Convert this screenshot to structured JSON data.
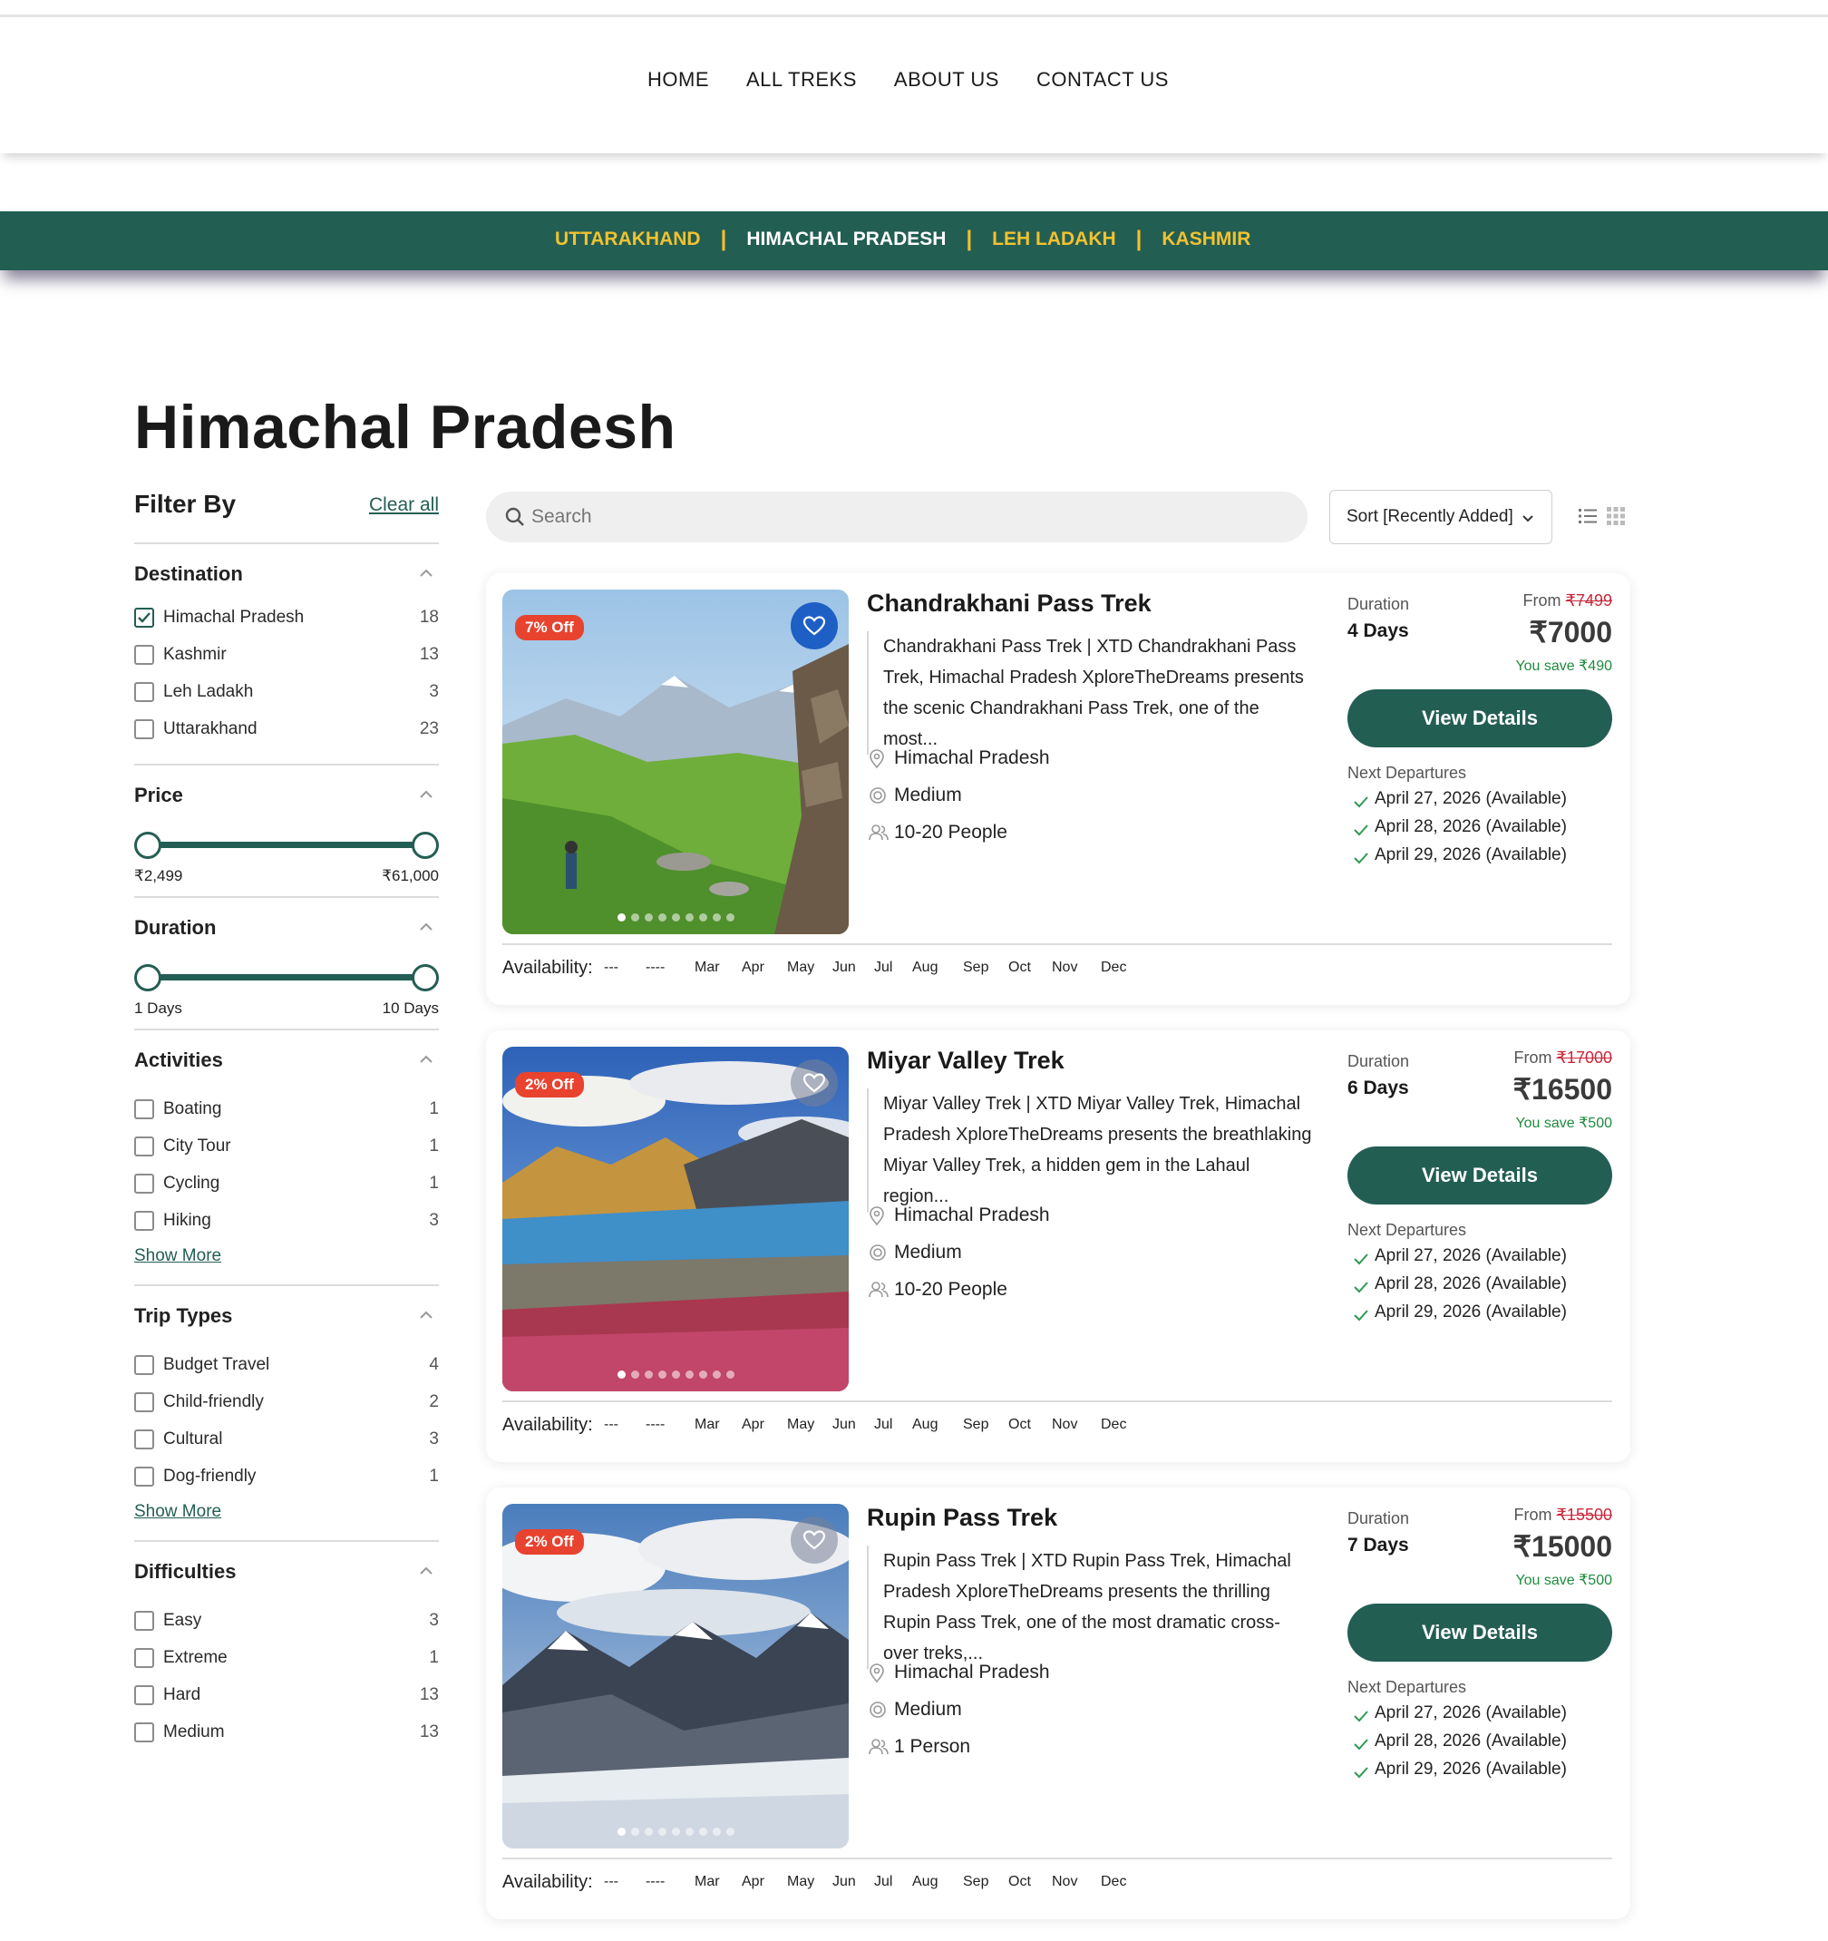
{
  "nav": [
    "HOME",
    "ALL TREKS",
    "ABOUT US",
    "CONTACT US"
  ],
  "regions": [
    {
      "label": "UTTARAKHAND",
      "active": false
    },
    {
      "label": "HIMACHAL PRADESH",
      "active": true
    },
    {
      "label": "LEH LADAKH",
      "active": false
    },
    {
      "label": "KASHMIR",
      "active": false
    }
  ],
  "page": {
    "title": "Himachal Pradesh"
  },
  "filters": {
    "title": "Filter By",
    "clear_label": "Clear all",
    "show_more": "Show More",
    "destination": {
      "title": "Destination",
      "items": [
        {
          "label": "Himachal Pradesh",
          "count": "18",
          "checked": true
        },
        {
          "label": "Kashmir",
          "count": "13",
          "checked": false
        },
        {
          "label": "Leh Ladakh",
          "count": "3",
          "checked": false
        },
        {
          "label": "Uttarakhand",
          "count": "23",
          "checked": false
        }
      ]
    },
    "price": {
      "title": "Price",
      "min": "₹2,499",
      "max": "₹61,000"
    },
    "duration": {
      "title": "Duration",
      "min": "1 Days",
      "max": "10 Days"
    },
    "activities": {
      "title": "Activities",
      "items": [
        {
          "label": "Boating",
          "count": "1"
        },
        {
          "label": "City Tour",
          "count": "1"
        },
        {
          "label": "Cycling",
          "count": "1"
        },
        {
          "label": "Hiking",
          "count": "3"
        }
      ]
    },
    "trip_types": {
      "title": "Trip Types",
      "items": [
        {
          "label": "Budget Travel",
          "count": "4"
        },
        {
          "label": "Child-friendly",
          "count": "2"
        },
        {
          "label": "Cultural",
          "count": "3"
        },
        {
          "label": "Dog-friendly",
          "count": "1"
        }
      ]
    },
    "difficulties": {
      "title": "Difficulties",
      "items": [
        {
          "label": "Easy",
          "count": "3"
        },
        {
          "label": "Extreme",
          "count": "1"
        },
        {
          "label": "Hard",
          "count": "13"
        },
        {
          "label": "Medium",
          "count": "13"
        }
      ]
    }
  },
  "search": {
    "placeholder": "Search"
  },
  "sort": {
    "label": "Sort [Recently Added]"
  },
  "card_labels": {
    "duration": "Duration",
    "from": "From",
    "view_details": "View Details",
    "next_departures": "Next Departures",
    "availability": "Availability:",
    "months": [
      "---",
      "----",
      "Mar",
      "Apr",
      "May",
      "Jun",
      "Jul",
      "Aug",
      "Sep",
      "Oct",
      "Nov",
      "Dec"
    ]
  },
  "treks": [
    {
      "discount": "7% Off",
      "title": "Chandrakhani Pass Trek",
      "description": "Chandrakhani Pass Trek | XTD Chandrakhani Pass Trek, Himachal Pradesh XploreTheDreams presents the scenic Chandrakhani Pass Trek, one of the most...",
      "location": "Himachal Pradesh",
      "difficulty": "Medium",
      "group": "10-20 People",
      "duration": "4 Days",
      "old_price": "₹7499",
      "price": "₹7000",
      "save": "You save ₹490",
      "departures": [
        "April 27, 2026 (Available)",
        "April 28, 2026 (Available)",
        "April 29, 2026 (Available)"
      ],
      "favorited": true
    },
    {
      "discount": "2% Off",
      "title": "Miyar Valley Trek",
      "description": "Miyar Valley Trek | XTD Miyar Valley Trek, Himachal Pradesh XploreTheDreams presents the breathlaking Miyar Valley Trek, a hidden gem in the Lahaul region...",
      "location": "Himachal Pradesh",
      "difficulty": "Medium",
      "group": "10-20 People",
      "duration": "6 Days",
      "old_price": "₹17000",
      "price": "₹16500",
      "save": "You save ₹500",
      "departures": [
        "April 27, 2026 (Available)",
        "April 28, 2026 (Available)",
        "April 29, 2026 (Available)"
      ],
      "favorited": false
    },
    {
      "discount": "2% Off",
      "title": "Rupin Pass Trek",
      "description": "Rupin Pass Trek | XTD Rupin Pass Trek, Himachal Pradesh XploreTheDreams presents the thrilling Rupin Pass Trek, one of the most dramatic cross-over treks,...",
      "location": "Himachal Pradesh",
      "difficulty": "Medium",
      "group": "1 Person",
      "duration": "7 Days",
      "old_price": "₹15500",
      "price": "₹15000",
      "save": "You save ₹500",
      "departures": [
        "April 27, 2026 (Available)",
        "April 28, 2026 (Available)",
        "April 29, 2026 (Available)"
      ],
      "favorited": false
    }
  ]
}
